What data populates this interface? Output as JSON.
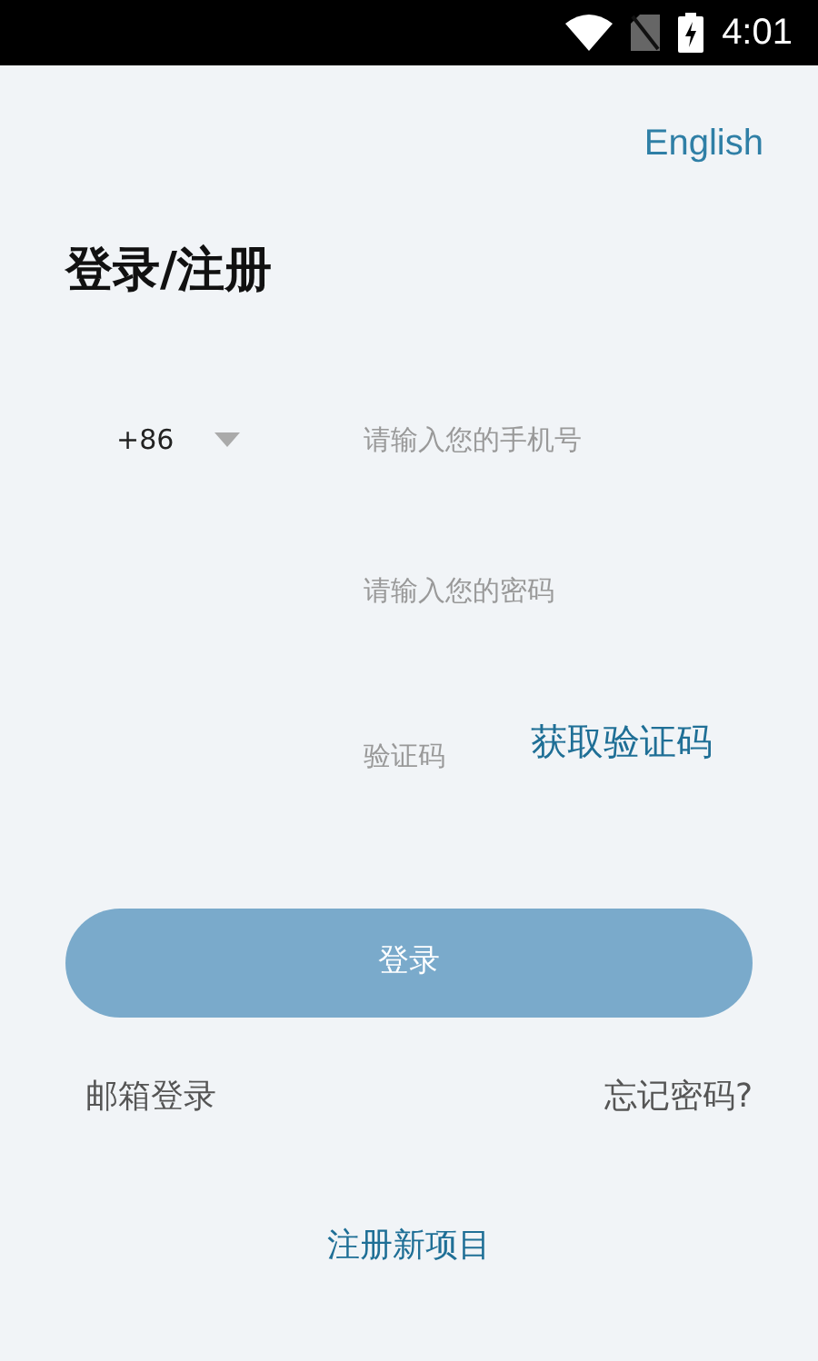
{
  "status_bar": {
    "time": "4:01"
  },
  "language_link": "English",
  "title": "登录/注册",
  "country_code": "+86",
  "phone": {
    "placeholder": "请输入您的手机号"
  },
  "password": {
    "placeholder": "请输入您的密码"
  },
  "code": {
    "placeholder": "验证码"
  },
  "get_code": "获取验证码",
  "login_button": "登录",
  "email_login": "邮箱登录",
  "forgot_password": "忘记密码?",
  "register": "注册新项目"
}
